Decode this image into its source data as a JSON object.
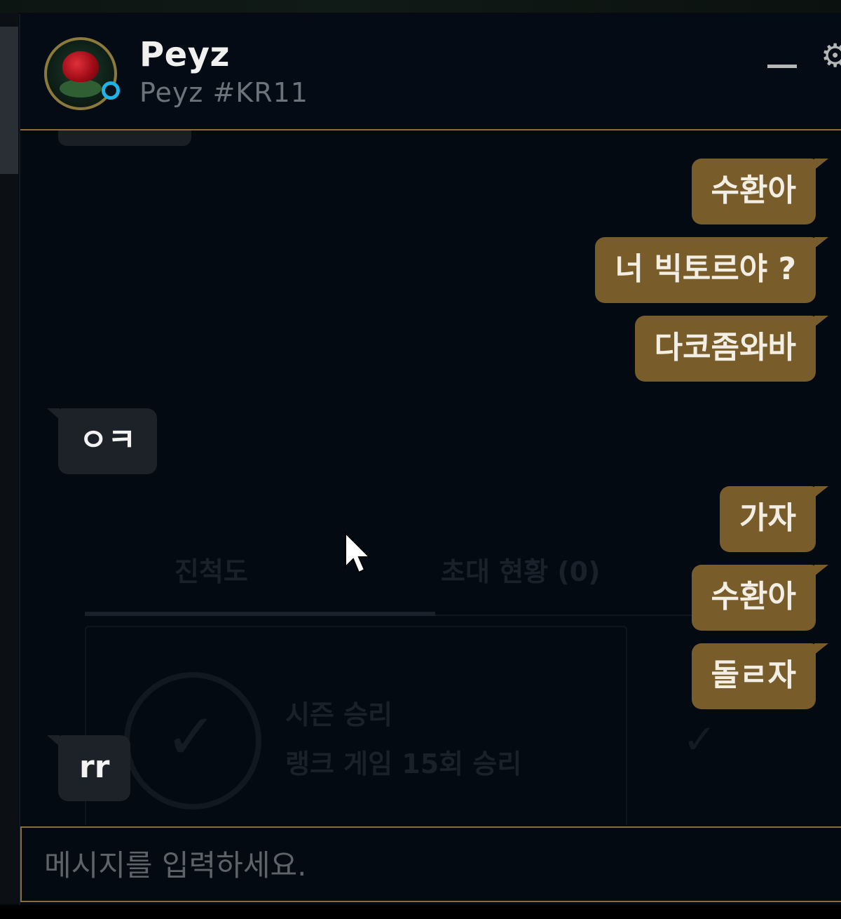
{
  "contact": {
    "name": "Peyz",
    "tag": "Peyz #KR11",
    "status": "online",
    "status_color": "#1fb4e6"
  },
  "header": {
    "minimize_icon": "minimize-icon",
    "settings_icon": "gear-icon"
  },
  "messages": [
    {
      "direction": "out",
      "text": "수환아"
    },
    {
      "direction": "out",
      "text": "너 빅토르야 ?"
    },
    {
      "direction": "out",
      "text": "다코좀와바"
    },
    {
      "direction": "in",
      "text": "ㅇㅋ"
    },
    {
      "direction": "out",
      "text": "가자"
    },
    {
      "direction": "out",
      "text": "수환아"
    },
    {
      "direction": "out",
      "text": "돌ㄹ자"
    },
    {
      "direction": "in",
      "text": "rr"
    }
  ],
  "background_panel": {
    "tab_progress": "진척도",
    "tab_invites": "초대 현황 (0)",
    "mission_title": "시즌 승리",
    "mission_desc": "랭크 게임 15회 승리"
  },
  "composer": {
    "placeholder": "메시지를 입력하세요."
  },
  "colors": {
    "outgoing_bubble": "#785d2b",
    "incoming_bubble": "#1d2228",
    "accent_gold": "#8a6e3a",
    "background": "#030a12"
  }
}
